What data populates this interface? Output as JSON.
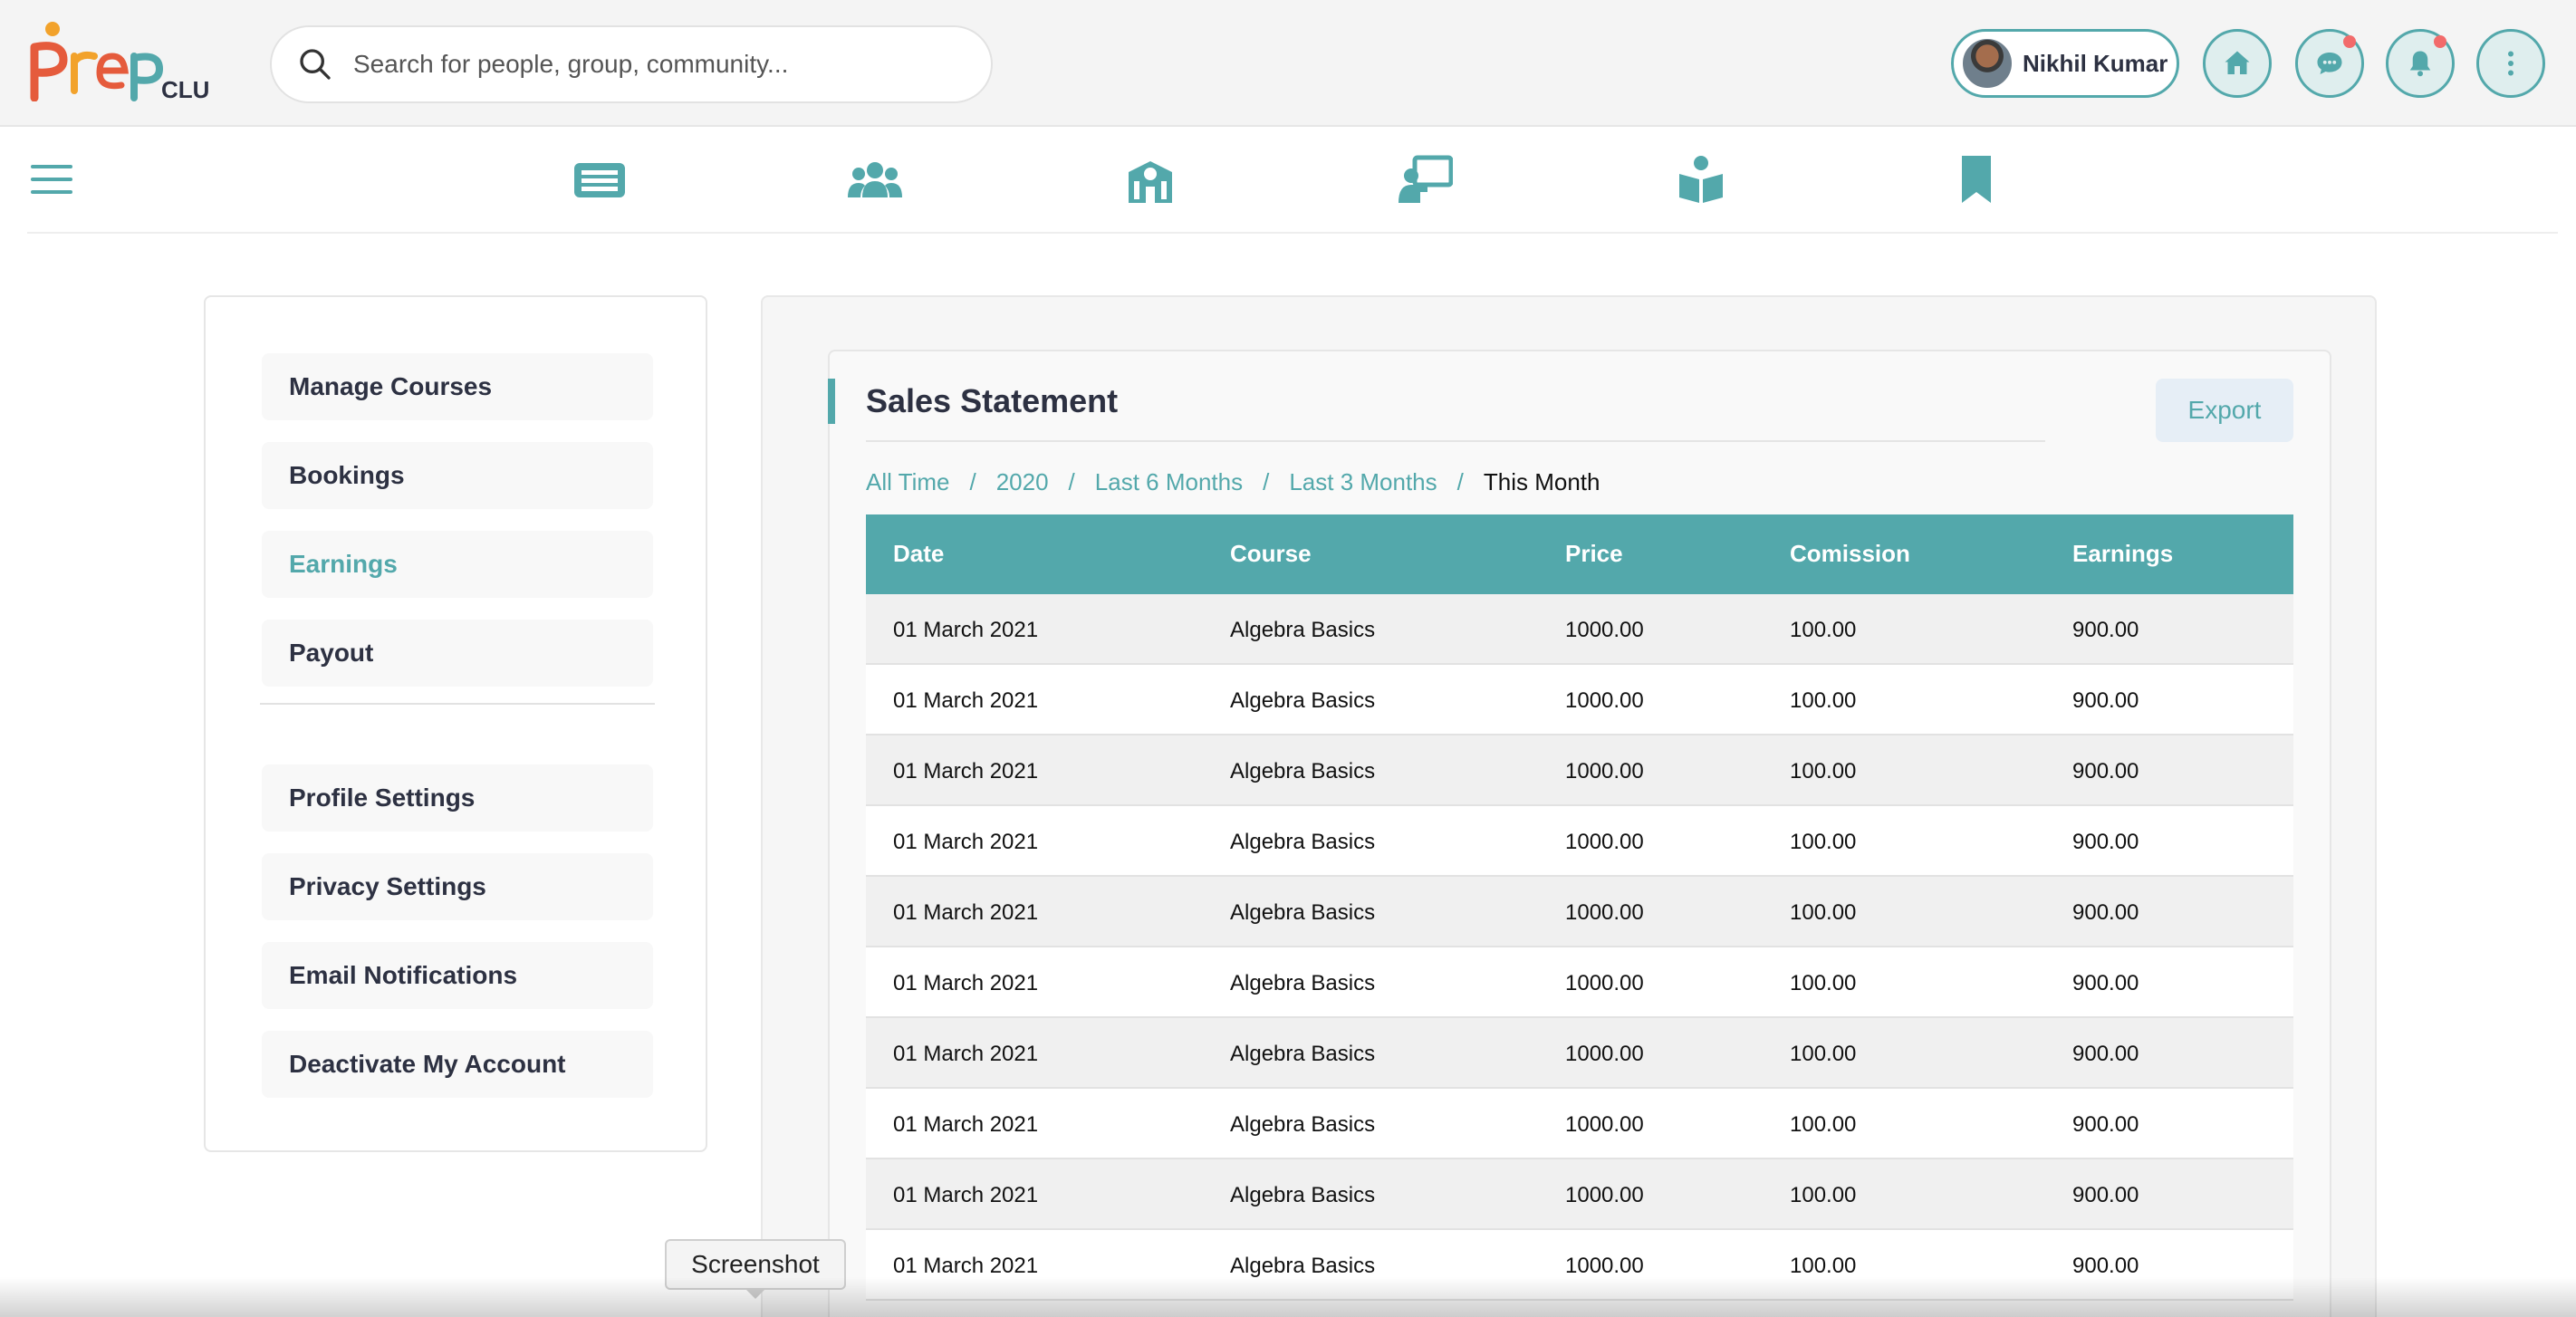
{
  "brand": {
    "logo_alt": "Prep Club logo",
    "logo_colors": [
      "#f2a22b",
      "#e55b3c",
      "#53a8ab",
      "#2d3142"
    ]
  },
  "header": {
    "search": {
      "placeholder": "Search for people, group, community...",
      "value": ""
    },
    "user": {
      "name": "Nikhil Kumar"
    },
    "buttons": [
      {
        "icon": "home-icon",
        "has_badge": false
      },
      {
        "icon": "chat-icon",
        "has_badge": true
      },
      {
        "icon": "bell-icon",
        "has_badge": true
      },
      {
        "icon": "more-vertical-icon",
        "has_badge": false
      }
    ]
  },
  "nav": {
    "menu_icon": "hamburger-icon",
    "items": [
      {
        "icon": "news-feed-icon"
      },
      {
        "icon": "groups-icon"
      },
      {
        "icon": "institution-icon"
      },
      {
        "icon": "teaching-icon"
      },
      {
        "icon": "reader-icon"
      },
      {
        "icon": "bookmark-icon"
      }
    ]
  },
  "sidebar": {
    "group1": [
      "Manage Courses",
      "Bookings",
      "Earnings",
      "Payout"
    ],
    "group2": [
      "Profile Settings",
      "Privacy Settings",
      "Email Notifications",
      "Deactivate My Account"
    ],
    "active": "Earnings"
  },
  "statement": {
    "title": "Sales Statement",
    "export_label": "Export",
    "filters": [
      "All Time",
      "2020",
      "Last 6 Months",
      "Last 3 Months"
    ],
    "current_filter": "This Month",
    "columns": [
      "Date",
      "Course",
      "Price",
      "Comission",
      "Earnings"
    ],
    "rows": [
      [
        "01 March 2021",
        "Algebra Basics",
        "1000.00",
        "100.00",
        "900.00"
      ],
      [
        "01 March 2021",
        "Algebra Basics",
        "1000.00",
        "100.00",
        "900.00"
      ],
      [
        "01 March 2021",
        "Algebra Basics",
        "1000.00",
        "100.00",
        "900.00"
      ],
      [
        "01 March 2021",
        "Algebra Basics",
        "1000.00",
        "100.00",
        "900.00"
      ],
      [
        "01 March 2021",
        "Algebra Basics",
        "1000.00",
        "100.00",
        "900.00"
      ],
      [
        "01 March 2021",
        "Algebra Basics",
        "1000.00",
        "100.00",
        "900.00"
      ],
      [
        "01 March 2021",
        "Algebra Basics",
        "1000.00",
        "100.00",
        "900.00"
      ],
      [
        "01 March 2021",
        "Algebra Basics",
        "1000.00",
        "100.00",
        "900.00"
      ],
      [
        "01 March 2021",
        "Algebra Basics",
        "1000.00",
        "100.00",
        "900.00"
      ],
      [
        "01 March 2021",
        "Algebra Basics",
        "1000.00",
        "100.00",
        "900.00"
      ]
    ]
  },
  "tooltip": {
    "text": "Screenshot"
  },
  "theme": {
    "accent": "#53a8ab",
    "text": "#2d3142",
    "badge": "#f26b6b"
  }
}
